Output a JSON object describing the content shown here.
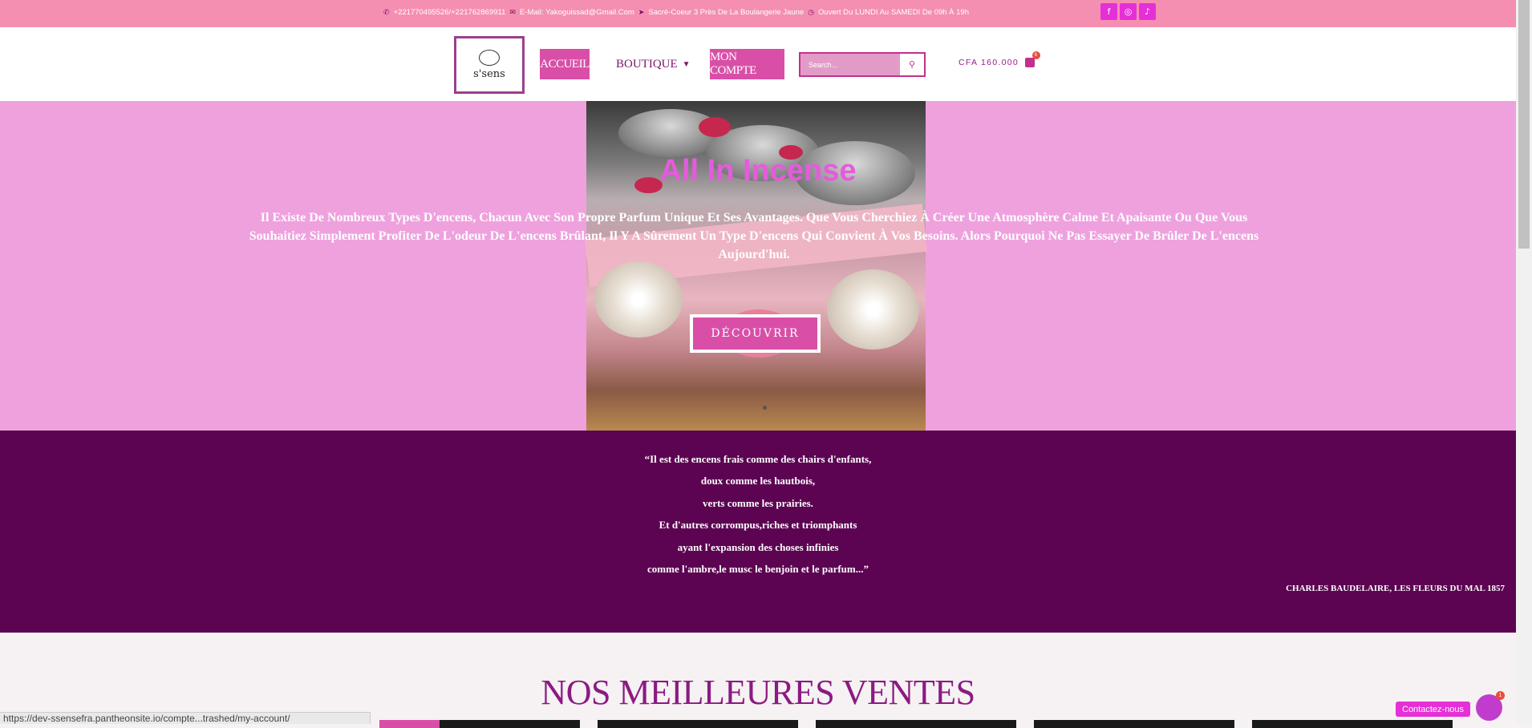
{
  "topbar": {
    "phone": "+221770495526/+221762869911",
    "email": "E-Mail: Yakoguissad@Gmail.Com",
    "address": "Sacré-Coeur 3 Près De La Boulangerie Jaune",
    "hours": "Ouvert Du LUNDI Au SAMEDI De 09h À 19h",
    "social": [
      "facebook-icon",
      "instagram-icon",
      "tiktok-icon"
    ]
  },
  "header": {
    "logo_text": "s'sens",
    "nav": {
      "home": "ACCUEIL",
      "shop": "BOUTIQUE",
      "account": "MON COMPTE"
    },
    "search_placeholder": "Search...",
    "cart_total": "CFA 160.000",
    "cart_count": "6"
  },
  "hero": {
    "title": "All In Incense",
    "description": "Il Existe De Nombreux Types D'encens, Chacun Avec Son Propre Parfum Unique Et Ses Avantages. Que Vous Cherchiez À Créer Une Atmosphère Calme Et Apaisante Ou Que Vous Souhaitiez Simplement Profiter De L'odeur De L'encens Brûlant, Il Y A Sûrement Un Type D'encens Qui Convient À Vos Besoins. Alors Pourquoi Ne Pas Essayer De Brûler De L'encens Aujourd'hui.",
    "cta": "DÉCOUVRIR"
  },
  "quote": {
    "lines": [
      "“Il est des encens frais comme des chairs d'enfants,",
      "doux comme les hautbois,",
      "verts comme les prairies.",
      "Et d'autres corrompus,riches et triomphants",
      "ayant l'expansion des choses infinies",
      "comme l'ambre,le musc le benjoin et le parfum...”"
    ],
    "author": "CHARLES BAUDELAIRE, LES FLEURS DU MAL 1857"
  },
  "best_sellers": {
    "title": "NOS MEILLEURES VENTES"
  },
  "status_url": "https://dev-ssensefra.pantheonsite.io/compte...trashed/my-account/",
  "contact": {
    "label": "Contactez-nous",
    "badge": "1"
  },
  "colors": {
    "topbar": "#f48fb1",
    "accent": "#d94fa8",
    "hero_bg": "#efa1de",
    "quote_bg": "#5c0452",
    "title": "#8b1a82"
  }
}
